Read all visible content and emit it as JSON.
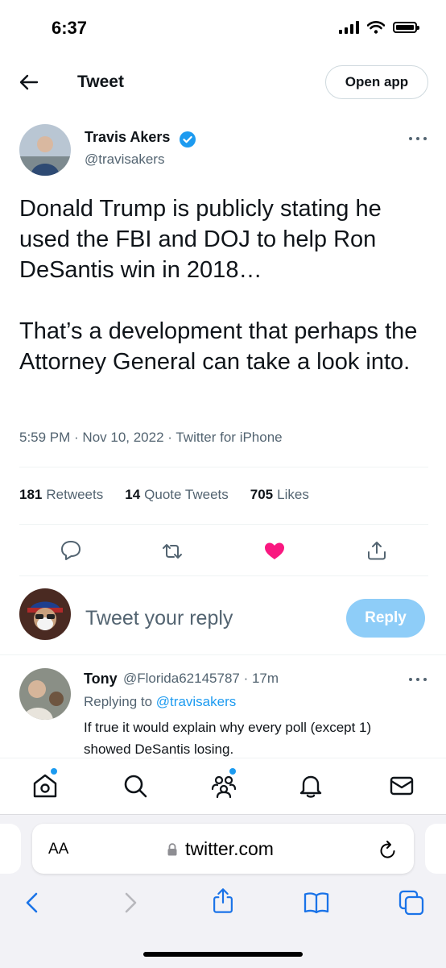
{
  "status_bar": {
    "time": "6:37"
  },
  "header": {
    "title": "Tweet",
    "open_app_label": "Open app",
    "back_icon": "arrow-left-icon"
  },
  "tweet": {
    "author_name": "Travis Akers",
    "author_handle": "@travisakers",
    "verified": true,
    "text": "Donald Trump is publicly stating he used the FBI and DOJ to help Ron DeSantis win in 2018…\n\nThat’s a development that perhaps the Attorney General can take a look into.",
    "meta": "5:59 PM · Nov 10, 2022 · Twitter for iPhone",
    "retweets_count": "181",
    "retweets_label": "Retweets",
    "quote_count": "14",
    "quote_label": "Quote Tweets",
    "likes_count": "705",
    "likes_label": "Likes",
    "liked": true
  },
  "composer": {
    "placeholder": "Tweet your reply",
    "reply_button": "Reply"
  },
  "reply": {
    "author_name": "Tony",
    "author_handle": "@Florida62145787 · 17m",
    "replying_prefix": "Replying to",
    "replying_to": "@travisakers",
    "text": "If true it would explain why every poll (except 1)\nshowed DeSantis losing."
  },
  "bottom_nav": [
    "home-icon",
    "search-icon",
    "communities-icon",
    "notifications-icon",
    "messages-icon"
  ],
  "browser": {
    "aa_label": "AA",
    "url": "twitter.com"
  },
  "colors": {
    "accent": "#1d9bf0",
    "like": "#f91880",
    "reply_button": "#8ecdf8"
  }
}
